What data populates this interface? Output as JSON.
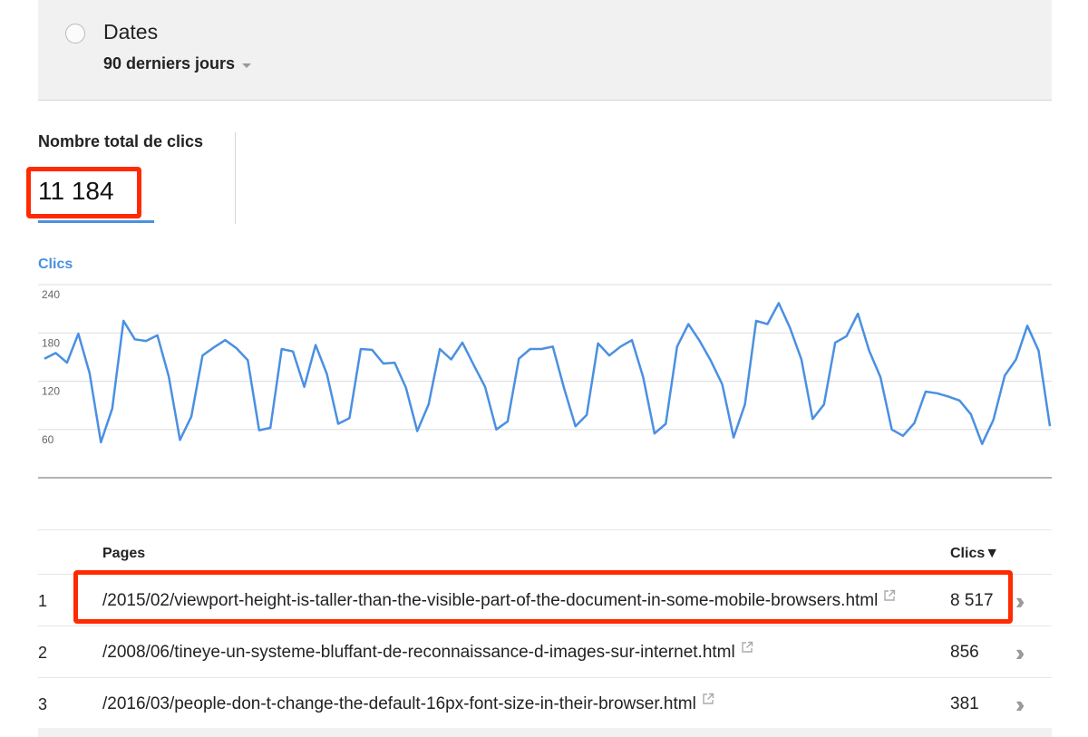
{
  "filter": {
    "title": "Dates",
    "range": "90 derniers jours"
  },
  "metric": {
    "label": "Nombre total de clics",
    "value": "11 184"
  },
  "chart_data": {
    "type": "line",
    "title": "Clics",
    "ylim": [
      0,
      240
    ],
    "yticks": [
      "240",
      "180",
      "120",
      "60"
    ],
    "grid": true,
    "series": [
      {
        "name": "Clics",
        "color": "#4a90e2",
        "values": [
          148,
          155,
          143,
          179,
          130,
          44,
          86,
          195,
          172,
          170,
          177,
          126,
          47,
          76,
          152,
          162,
          171,
          161,
          146,
          59,
          62,
          160,
          157,
          113,
          165,
          129,
          67,
          74,
          160,
          159,
          142,
          143,
          112,
          58,
          91,
          160,
          147,
          168,
          140,
          113,
          60,
          70,
          148,
          160,
          160,
          163,
          111,
          64,
          78,
          167,
          152,
          163,
          171,
          125,
          55,
          67,
          163,
          191,
          170,
          145,
          116,
          50,
          91,
          195,
          191,
          217,
          186,
          147,
          73,
          91,
          168,
          176,
          204,
          158,
          125,
          60,
          52,
          68,
          107,
          105,
          101,
          96,
          79,
          42,
          72,
          127,
          147,
          189,
          158,
          64
        ]
      }
    ]
  },
  "table": {
    "columns": {
      "pages": "Pages",
      "clics": "Clics▼"
    },
    "rows": [
      {
        "rank": "1",
        "page": "/2015/02/viewport-height-is-taller-than-the-visible-part-of-the-document-in-some-mobile-browsers.html",
        "clics": "8 517"
      },
      {
        "rank": "2",
        "page": "/2008/06/tineye-un-systeme-bluffant-de-reconnaissance-d-images-sur-internet.html",
        "clics": "856"
      },
      {
        "rank": "3",
        "page": "/2016/03/people-don-t-change-the-default-16px-font-size-in-their-browser.html",
        "clics": "381"
      }
    ]
  },
  "icons": {
    "external_link": "external-link-icon",
    "details": "double-chevron-right-icon"
  },
  "colors": {
    "accent": "#4a90e2",
    "highlight": "#ff2a00"
  }
}
